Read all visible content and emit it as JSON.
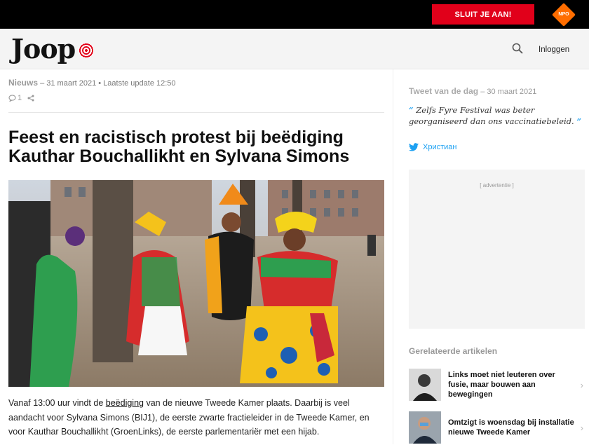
{
  "topbar": {
    "join_label": "SLUIT JE AAN!",
    "npo_label": "NPO"
  },
  "header": {
    "logo_text": "Joop",
    "login_label": "Inloggen"
  },
  "article": {
    "category": "Nieuws",
    "date": "– 31 maart 2021",
    "update": "• Laatste update 12:50",
    "comment_count": "1",
    "headline": "Feest en racistisch protest bij beëdiging Kauthar Bouchallikht en Sylvana Simons",
    "lead_pre": "Vanaf 13:00 uur vindt de ",
    "lead_link": "beëdiging",
    "lead_post": " van de nieuwe Tweede Kamer plaats. Daarbij is veel aandacht voor Sylvana Simons (BIJ1), de eerste zwarte fractieleider in de Tweede Kamer, en voor Kauthar Bouchallikht (GroenLinks), de eerste parlementariër met een hijab."
  },
  "sidebar": {
    "tweet_label": "Tweet van de dag",
    "tweet_date": "– 30 maart 2021",
    "tweet_open": "“",
    "tweet_text": "Zelfs Fyre Festival was beter georganiseerd dan ons vaccinatiebeleid.",
    "tweet_close": "”",
    "tweet_author": "Христиан",
    "ad_label": "[ advertentie ]",
    "related_label": "Gerelateerde artikelen",
    "related": [
      {
        "title": "Links moet niet leuteren over fusie, maar bouwen aan bewegingen"
      },
      {
        "title": "Omtzigt is woensdag bij installatie nieuwe Tweede Kamer"
      }
    ]
  },
  "colors": {
    "brand_red": "#e1001a",
    "twitter_blue": "#1da1f2",
    "npo_orange": "#ff6d00"
  }
}
